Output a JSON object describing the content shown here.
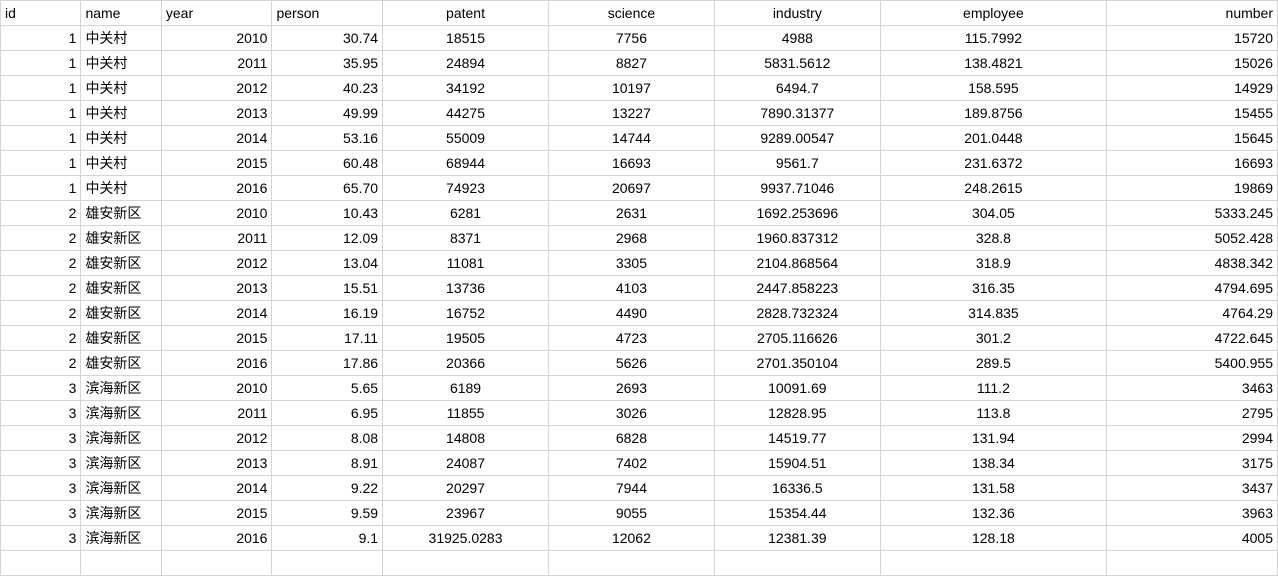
{
  "headers": {
    "id": "id",
    "name": "name",
    "year": "year",
    "person": "person",
    "patent": "patent",
    "science": "science",
    "industry": "industry",
    "employee": "employee",
    "number": "number"
  },
  "rows": [
    {
      "id": "1",
      "name": "中关村",
      "year": "2010",
      "person": "30.74",
      "patent": "18515",
      "science": "7756",
      "industry": "4988",
      "employee": "115.7992",
      "number": "15720"
    },
    {
      "id": "1",
      "name": "中关村",
      "year": "2011",
      "person": "35.95",
      "patent": "24894",
      "science": "8827",
      "industry": "5831.5612",
      "employee": "138.4821",
      "number": "15026"
    },
    {
      "id": "1",
      "name": "中关村",
      "year": "2012",
      "person": "40.23",
      "patent": "34192",
      "science": "10197",
      "industry": "6494.7",
      "employee": "158.595",
      "number": "14929"
    },
    {
      "id": "1",
      "name": "中关村",
      "year": "2013",
      "person": "49.99",
      "patent": "44275",
      "science": "13227",
      "industry": "7890.31377",
      "employee": "189.8756",
      "number": "15455"
    },
    {
      "id": "1",
      "name": "中关村",
      "year": "2014",
      "person": "53.16",
      "patent": "55009",
      "science": "14744",
      "industry": "9289.00547",
      "employee": "201.0448",
      "number": "15645"
    },
    {
      "id": "1",
      "name": "中关村",
      "year": "2015",
      "person": "60.48",
      "patent": "68944",
      "science": "16693",
      "industry": "9561.7",
      "employee": "231.6372",
      "number": "16693"
    },
    {
      "id": "1",
      "name": "中关村",
      "year": "2016",
      "person": "65.70",
      "patent": "74923",
      "science": "20697",
      "industry": "9937.71046",
      "employee": "248.2615",
      "number": "19869"
    },
    {
      "id": "2",
      "name": "雄安新区",
      "year": "2010",
      "person": "10.43",
      "patent": "6281",
      "science": "2631",
      "industry": "1692.253696",
      "employee": "304.05",
      "number": "5333.245"
    },
    {
      "id": "2",
      "name": "雄安新区",
      "year": "2011",
      "person": "12.09",
      "patent": "8371",
      "science": "2968",
      "industry": "1960.837312",
      "employee": "328.8",
      "number": "5052.428"
    },
    {
      "id": "2",
      "name": "雄安新区",
      "year": "2012",
      "person": "13.04",
      "patent": "11081",
      "science": "3305",
      "industry": "2104.868564",
      "employee": "318.9",
      "number": "4838.342"
    },
    {
      "id": "2",
      "name": "雄安新区",
      "year": "2013",
      "person": "15.51",
      "patent": "13736",
      "science": "4103",
      "industry": "2447.858223",
      "employee": "316.35",
      "number": "4794.695"
    },
    {
      "id": "2",
      "name": "雄安新区",
      "year": "2014",
      "person": "16.19",
      "patent": "16752",
      "science": "4490",
      "industry": "2828.732324",
      "employee": "314.835",
      "number": "4764.29"
    },
    {
      "id": "2",
      "name": "雄安新区",
      "year": "2015",
      "person": "17.11",
      "patent": "19505",
      "science": "4723",
      "industry": "2705.116626",
      "employee": "301.2",
      "number": "4722.645"
    },
    {
      "id": "2",
      "name": "雄安新区",
      "year": "2016",
      "person": "17.86",
      "patent": "20366",
      "science": "5626",
      "industry": "2701.350104",
      "employee": "289.5",
      "number": "5400.955"
    },
    {
      "id": "3",
      "name": "滨海新区",
      "year": "2010",
      "person": "5.65",
      "patent": "6189",
      "science": "2693",
      "industry": "10091.69",
      "employee": "111.2",
      "number": "3463"
    },
    {
      "id": "3",
      "name": "滨海新区",
      "year": "2011",
      "person": "6.95",
      "patent": "11855",
      "science": "3026",
      "industry": "12828.95",
      "employee": "113.8",
      "number": "2795"
    },
    {
      "id": "3",
      "name": "滨海新区",
      "year": "2012",
      "person": "8.08",
      "patent": "14808",
      "science": "6828",
      "industry": "14519.77",
      "employee": "131.94",
      "number": "2994"
    },
    {
      "id": "3",
      "name": "滨海新区",
      "year": "2013",
      "person": "8.91",
      "patent": "24087",
      "science": "7402",
      "industry": "15904.51",
      "employee": "138.34",
      "number": "3175"
    },
    {
      "id": "3",
      "name": "滨海新区",
      "year": "2014",
      "person": "9.22",
      "patent": "20297",
      "science": "7944",
      "industry": "16336.5",
      "employee": "131.58",
      "number": "3437"
    },
    {
      "id": "3",
      "name": "滨海新区",
      "year": "2015",
      "person": "9.59",
      "patent": "23967",
      "science": "9055",
      "industry": "15354.44",
      "employee": "132.36",
      "number": "3963"
    },
    {
      "id": "3",
      "name": "滨海新区",
      "year": "2016",
      "person": "9.1",
      "patent": "31925.0283",
      "science": "12062",
      "industry": "12381.39",
      "employee": "128.18",
      "number": "4005"
    }
  ]
}
